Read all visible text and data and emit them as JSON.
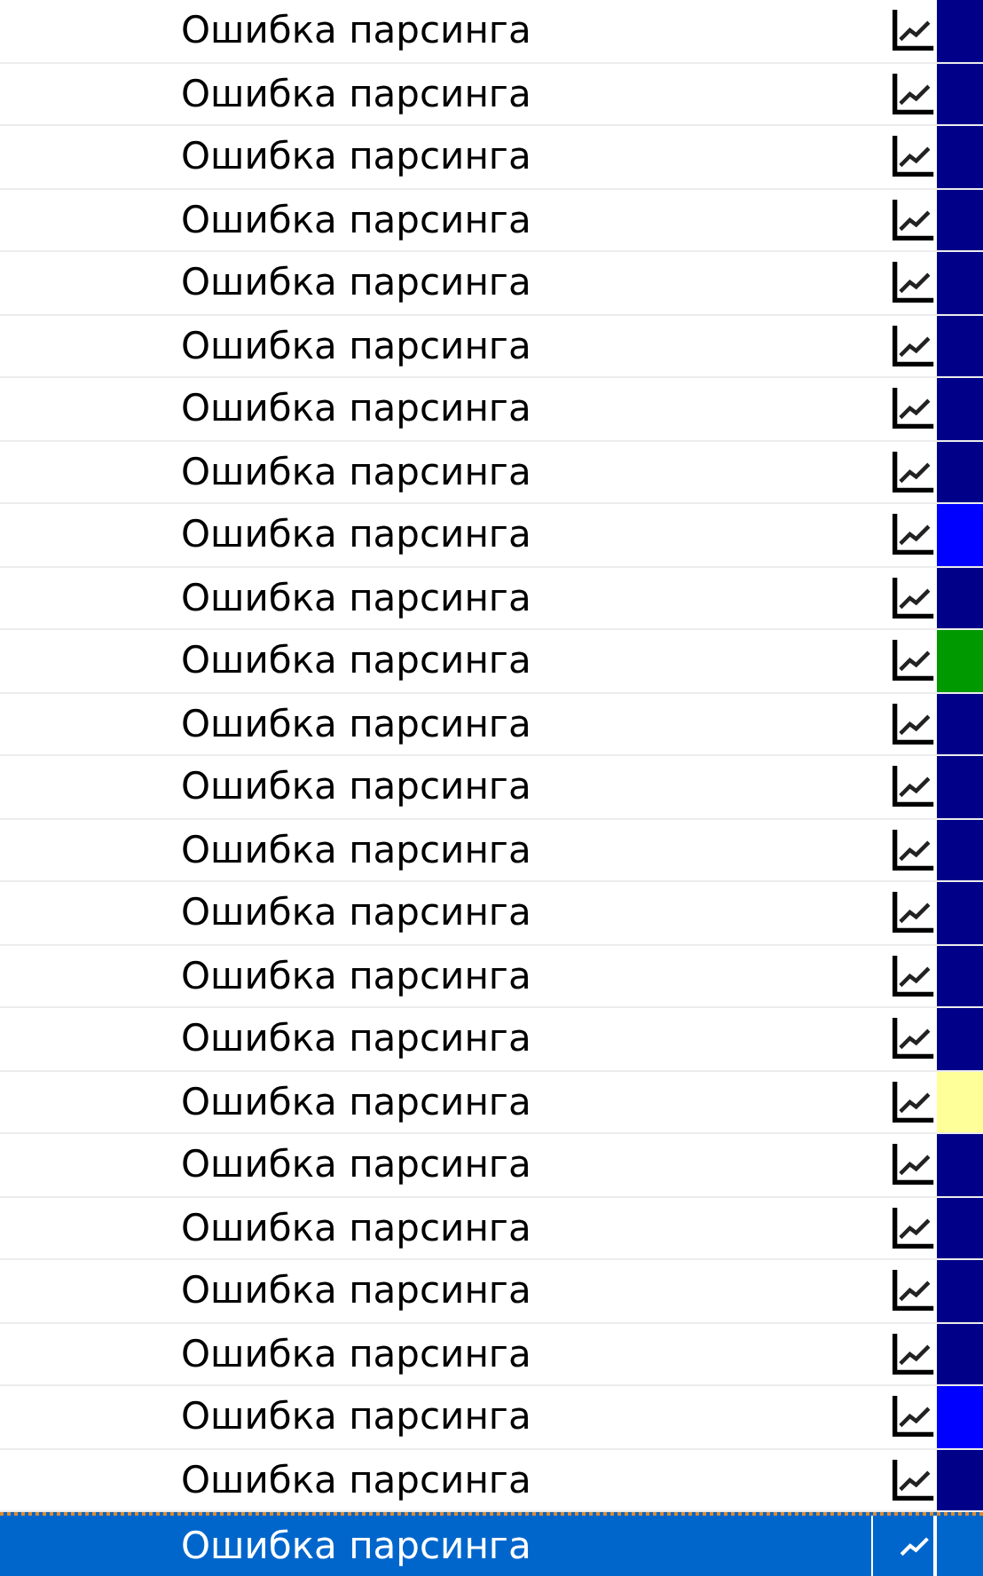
{
  "rows": [
    {
      "status": "Ошибка парсинга",
      "color": "#000088",
      "selected": false
    },
    {
      "status": "Ошибка парсинга",
      "color": "#000088",
      "selected": false
    },
    {
      "status": "Ошибка парсинга",
      "color": "#000088",
      "selected": false
    },
    {
      "status": "Ошибка парсинга",
      "color": "#000088",
      "selected": false
    },
    {
      "status": "Ошибка парсинга",
      "color": "#000088",
      "selected": false
    },
    {
      "status": "Ошибка парсинга",
      "color": "#000088",
      "selected": false
    },
    {
      "status": "Ошибка парсинга",
      "color": "#000088",
      "selected": false
    },
    {
      "status": "Ошибка парсинга",
      "color": "#000088",
      "selected": false
    },
    {
      "status": "Ошибка парсинга",
      "color": "#0000ff",
      "selected": false
    },
    {
      "status": "Ошибка парсинга",
      "color": "#000088",
      "selected": false
    },
    {
      "status": "Ошибка парсинга",
      "color": "#009900",
      "selected": false
    },
    {
      "status": "Ошибка парсинга",
      "color": "#000088",
      "selected": false
    },
    {
      "status": "Ошибка парсинга",
      "color": "#000088",
      "selected": false
    },
    {
      "status": "Ошибка парсинга",
      "color": "#000088",
      "selected": false
    },
    {
      "status": "Ошибка парсинга",
      "color": "#000088",
      "selected": false
    },
    {
      "status": "Ошибка парсинга",
      "color": "#000088",
      "selected": false
    },
    {
      "status": "Ошибка парсинга",
      "color": "#000088",
      "selected": false
    },
    {
      "status": "Ошибка парсинга",
      "color": "#ffff99",
      "selected": false
    },
    {
      "status": "Ошибка парсинга",
      "color": "#000088",
      "selected": false
    },
    {
      "status": "Ошибка парсинга",
      "color": "#000088",
      "selected": false
    },
    {
      "status": "Ошибка парсинга",
      "color": "#000088",
      "selected": false
    },
    {
      "status": "Ошибка парсинга",
      "color": "#000088",
      "selected": false
    },
    {
      "status": "Ошибка парсинга",
      "color": "#0000ff",
      "selected": false
    },
    {
      "status": "Ошибка парсинга",
      "color": "#000088",
      "selected": false
    },
    {
      "status": "Ошибка парсинга",
      "selected": true
    }
  ]
}
